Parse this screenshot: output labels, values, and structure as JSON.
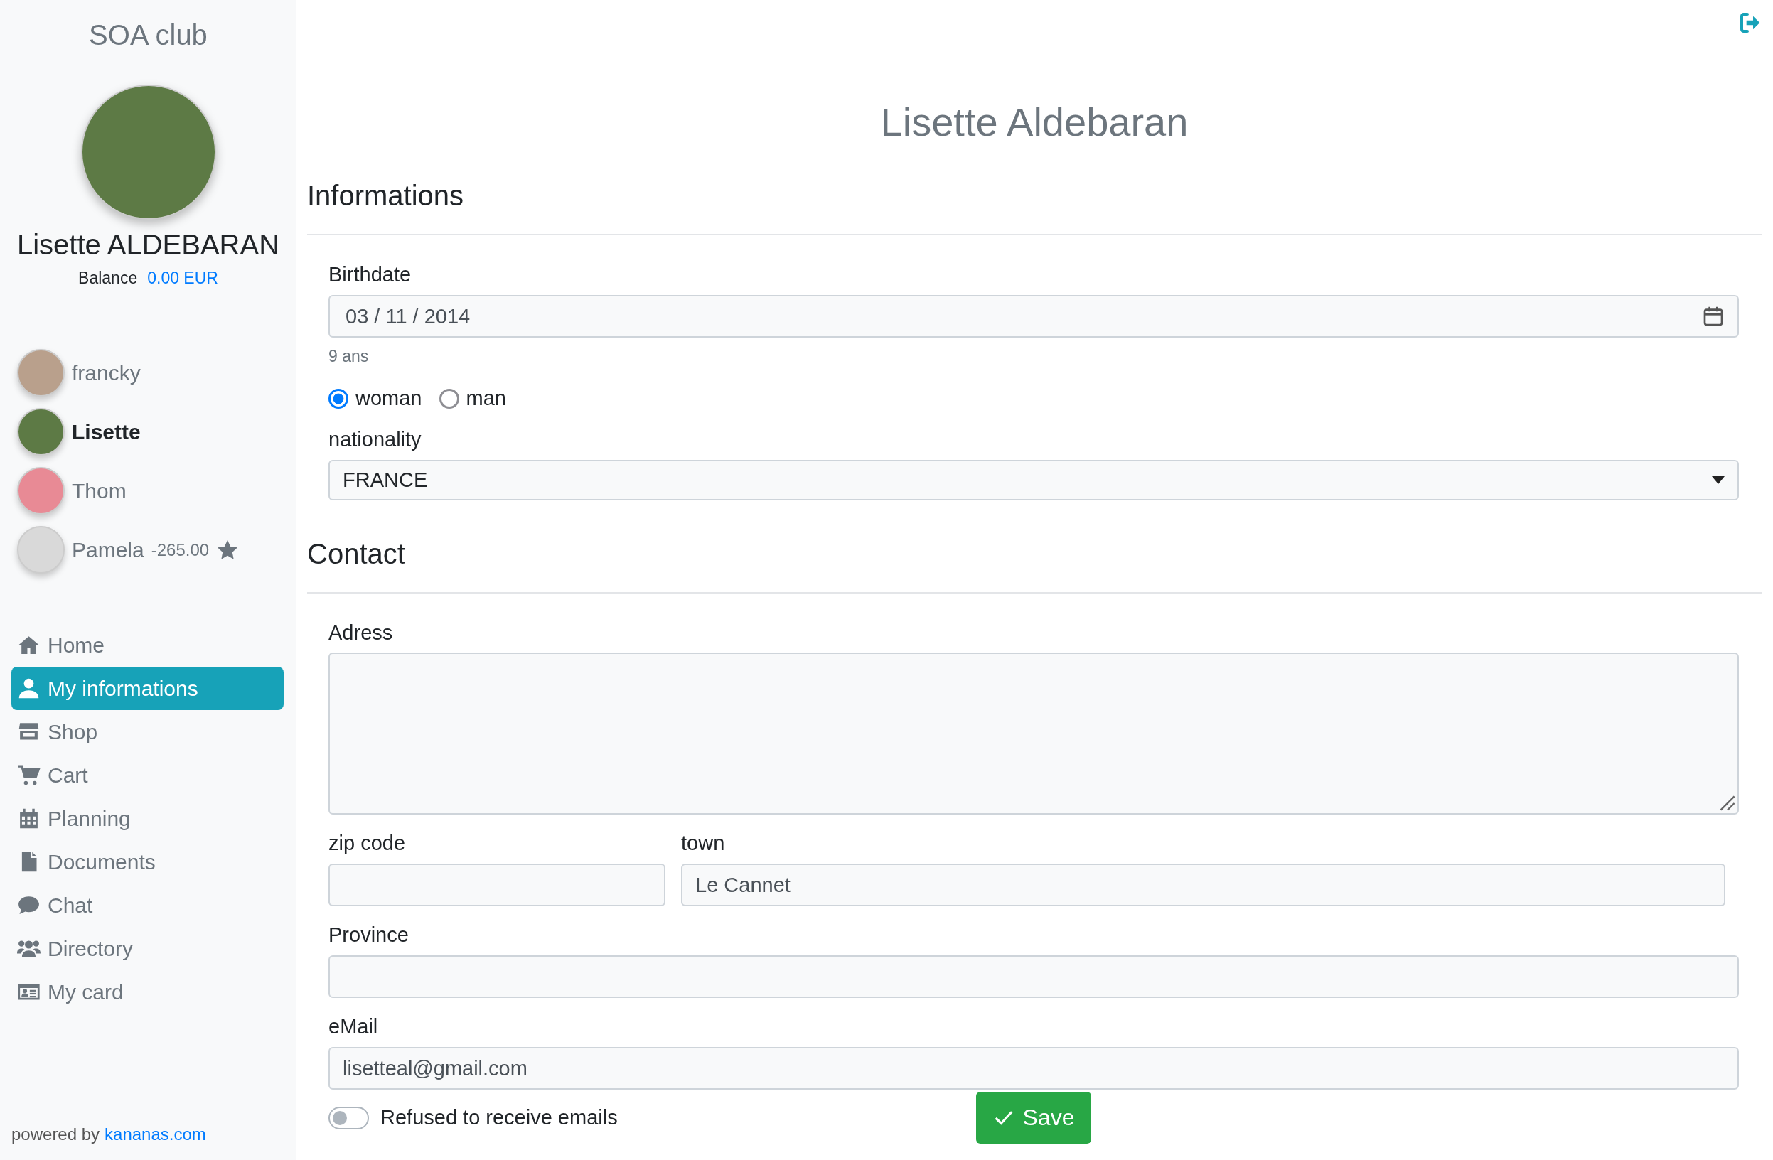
{
  "sidebar": {
    "club_name": "SOA club",
    "profile": {
      "name": "Lisette ALDEBARAN",
      "balance_label": "Balance",
      "balance_value": "0.00 EUR"
    },
    "members": [
      {
        "name": "francky",
        "selected": false,
        "starred": false
      },
      {
        "name": "Lisette",
        "selected": true,
        "starred": false
      },
      {
        "name": "Thom",
        "selected": false,
        "starred": false
      },
      {
        "name": "Pamela",
        "amount": "-265.00",
        "selected": false,
        "starred": true
      }
    ],
    "nav": [
      {
        "label": "Home",
        "kind": "home",
        "selected": false
      },
      {
        "label": "My informations",
        "kind": "user",
        "selected": true
      },
      {
        "label": "Shop",
        "kind": "store",
        "selected": false
      },
      {
        "label": "Cart",
        "kind": "cart",
        "selected": false
      },
      {
        "label": "Planning",
        "kind": "calendar",
        "selected": false
      },
      {
        "label": "Documents",
        "kind": "file",
        "selected": false
      },
      {
        "label": "Chat",
        "kind": "chat",
        "selected": false
      },
      {
        "label": "Directory",
        "kind": "users",
        "selected": false
      },
      {
        "label": "My card",
        "kind": "card",
        "selected": false
      }
    ],
    "footer": {
      "prefix": "powered by",
      "link": "kananas.com"
    }
  },
  "main": {
    "title": "Lisette Aldebaran",
    "informations": {
      "heading": "Informations",
      "birthdate": {
        "label": "Birthdate",
        "value": "03 / 11 / 2014",
        "hint": "9 ans"
      },
      "gender": [
        {
          "label": "woman",
          "selected": true
        },
        {
          "label": "man",
          "selected": false
        }
      ],
      "nationality": {
        "label": "nationality",
        "value": "FRANCE"
      }
    },
    "contact": {
      "heading": "Contact",
      "address": {
        "label": "Adress"
      },
      "zip_code": {
        "label": "zip code"
      },
      "town": {
        "label": "town",
        "value": "Le Cannet"
      },
      "province": {
        "label": "Province"
      },
      "email": {
        "label": "eMail",
        "value": "lisetteal@gmail.com"
      },
      "refuse_emails": {
        "label": "Refused to receive emails",
        "on": false
      }
    },
    "save_button": "Save"
  }
}
